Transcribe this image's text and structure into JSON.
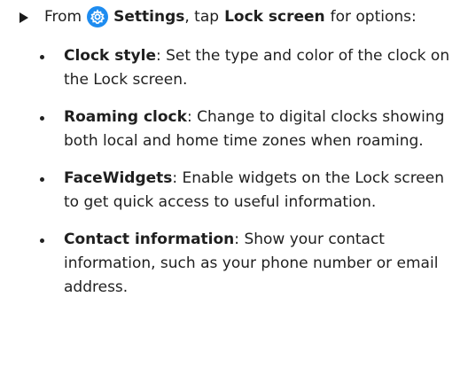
{
  "intro": {
    "prefix": "From",
    "settings": "Settings",
    "middle": ", tap",
    "lock_screen": "Lock screen",
    "suffix": "for options:",
    "icon": "settings-gear-icon"
  },
  "items": [
    {
      "label": "Clock style",
      "sep": ":",
      "description": "Set the type and color of the clock on the Lock screen."
    },
    {
      "label": "Roaming clock",
      "sep": ":",
      "description": "Change to digital clocks showing both local and home time zones when roaming."
    },
    {
      "label": "FaceWidgets",
      "sep": ":",
      "description": "Enable widgets on the Lock screen to get quick access to useful information."
    },
    {
      "label": "Contact information",
      "sep": ":",
      "description": "Show your contact information, such as your phone number or email address."
    }
  ],
  "colors": {
    "text": "#1f1f1f",
    "icon_blue": "#1e8cf0"
  }
}
